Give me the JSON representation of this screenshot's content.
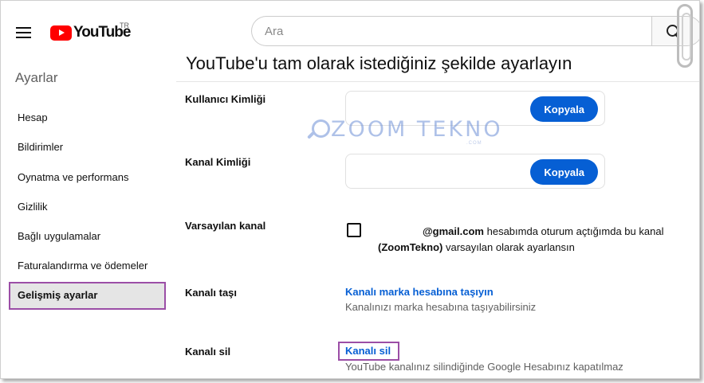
{
  "header": {
    "logo_text": "YouTube",
    "country_code": "TR",
    "search_placeholder": "Ara"
  },
  "sidebar": {
    "title": "Ayarlar",
    "items": [
      {
        "label": "Hesap"
      },
      {
        "label": "Bildirimler"
      },
      {
        "label": "Oynatma ve performans"
      },
      {
        "label": "Gizlilik"
      },
      {
        "label": "Bağlı uygulamalar"
      },
      {
        "label": "Faturalandırma ve ödemeler"
      },
      {
        "label": "Gelişmiş ayarlar",
        "active": true
      }
    ]
  },
  "main": {
    "title": "YouTube'u tam olarak istediğiniz şekilde ayarlayın",
    "user_id": {
      "label": "Kullanıcı Kimliği",
      "button": "Kopyala"
    },
    "channel_id": {
      "label": "Kanal Kimliği",
      "button": "Kopyala"
    },
    "default_channel": {
      "label": "Varsayılan kanal",
      "email": "@gmail.com",
      "text1": "hesabımda oturum açtığımda bu kanal",
      "channel_name": "(ZoomTekno)",
      "text2": "varsayılan olarak ayarlansın"
    },
    "move_channel": {
      "label": "Kanalı taşı",
      "link": "Kanalı marka hesabına taşıyın",
      "description": "Kanalınızı marka hesabına taşıyabilirsiniz"
    },
    "delete_channel": {
      "label": "Kanalı sil",
      "link": "Kanalı sil",
      "description": "YouTube kanalınız silindiğinde Google Hesabınız kapatılmaz"
    }
  },
  "watermark": {
    "text": "ZOOM TEKNO",
    "sub": ".COM"
  },
  "colors": {
    "accent_blue": "#065fd4",
    "brand_red": "#ff0000",
    "highlight_purple": "#9b4ea6"
  }
}
